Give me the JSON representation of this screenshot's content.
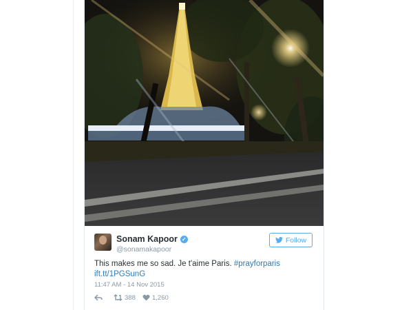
{
  "tweet": {
    "author_name": "Sonam Kapoor",
    "author_handle": "@sonamakapoor",
    "verified": true,
    "follow_label": "Follow",
    "text_main": "This makes me so sad. Je t'aime  Paris. ",
    "hashtag": "#prayforparis",
    "link": "ift.tt/1PGSunG",
    "timestamp": "11:47 AM - 14 Nov 2015",
    "retweets": "388",
    "likes": "1,260"
  },
  "icons": {
    "bird": "twitter-bird-icon",
    "verified": "verified-badge-icon",
    "reply": "reply-icon",
    "retweet": "retweet-icon",
    "like": "heart-icon"
  },
  "colors": {
    "accent": "#55acee",
    "link": "#2b7bb9",
    "text": "#292f33",
    "muted": "#8899a6"
  }
}
